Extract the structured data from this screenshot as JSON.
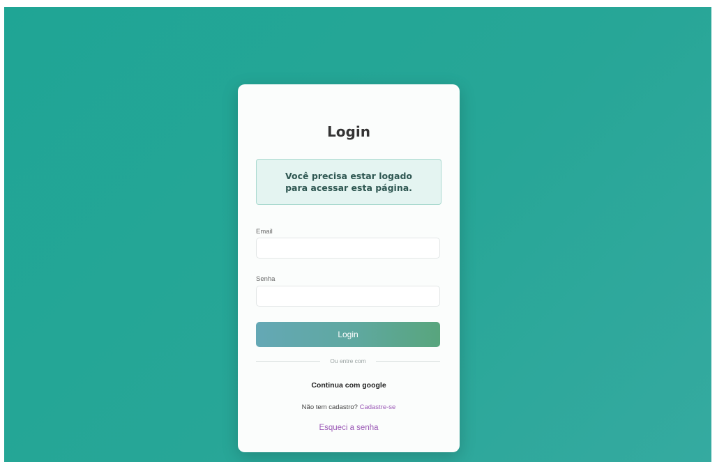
{
  "login": {
    "title": "Login",
    "alert_message": "Você precisa estar logado para acessar esta página.",
    "email_label": "Email",
    "email_value": "",
    "password_label": "Senha",
    "password_value": "",
    "submit_label": "Login",
    "divider_text": "Ou entre com",
    "google_label": "Continua com google",
    "signup_prompt": "Não tem cadastro?",
    "signup_link": "Cadastre-se",
    "forgot_link": "Esqueci a senha"
  },
  "colors": {
    "background_gradient_start": "#1fa595",
    "background_gradient_end": "#35aaa0",
    "button_gradient_start": "#64a8b5",
    "button_gradient_end": "#58a57d",
    "link": "#9b59b6",
    "alert_background": "#e4f4f1"
  }
}
